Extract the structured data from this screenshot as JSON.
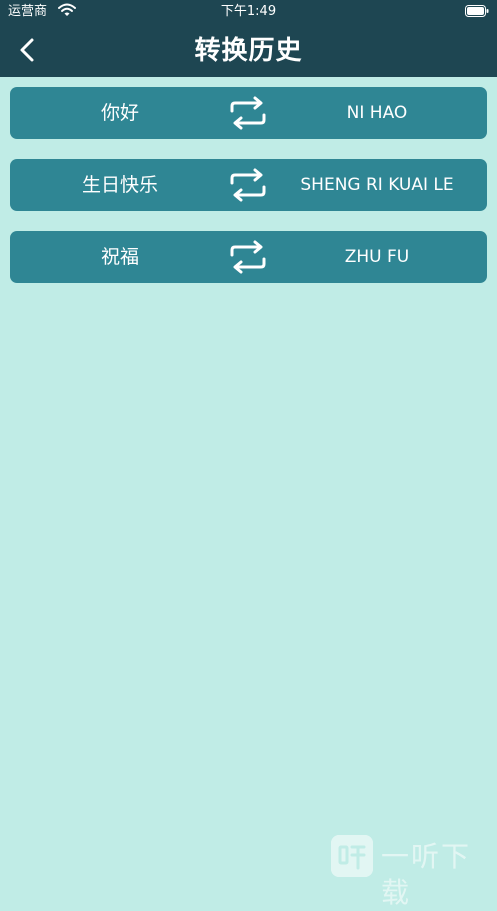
{
  "status_bar": {
    "carrier": "运营商",
    "time": "下午1:49"
  },
  "nav": {
    "title": "转换历史"
  },
  "history": [
    {
      "source": "你好",
      "result": "NI HAO"
    },
    {
      "source": "生日快乐",
      "result": "SHENG RI KUAI LE"
    },
    {
      "source": "祝福",
      "result": "ZHU FU"
    }
  ],
  "watermark": {
    "text": "一听下载"
  },
  "colors": {
    "header": "#1e4652",
    "background": "#c0ece6",
    "row": "#2f8694"
  }
}
